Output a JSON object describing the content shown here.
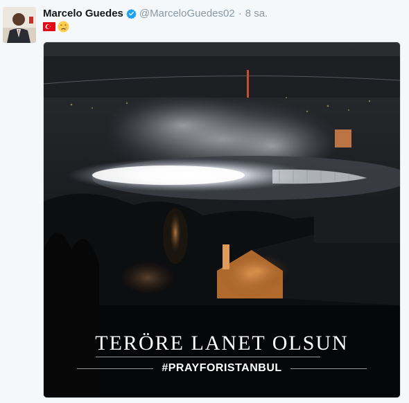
{
  "tweet": {
    "author_name": "Marcelo Guedes",
    "handle": "@MarceloGuedes02",
    "separator": "·",
    "time": "8 sa.",
    "verified": true,
    "emojis": [
      "turkey-flag-icon",
      "crying-face-icon"
    ]
  },
  "media": {
    "caption": "TERÖRE LANET OLSUN",
    "hashtag": "#PRAYFORISTANBUL"
  },
  "colors": {
    "name": "#14171a",
    "muted": "#8899a6",
    "verified": "#1da1f2",
    "background": "#f5f8fa"
  }
}
